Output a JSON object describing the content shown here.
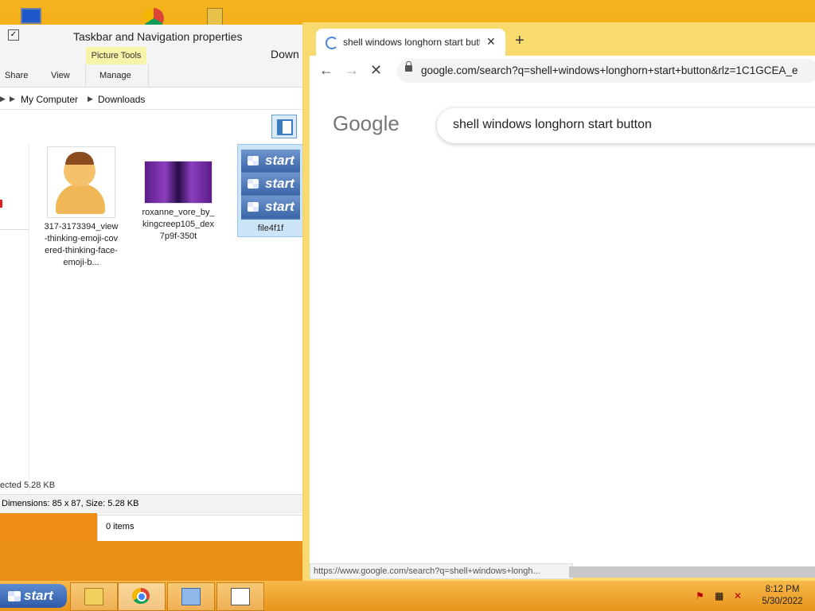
{
  "explorer": {
    "title": "Taskbar and Navigation properties",
    "ribbon": {
      "contextual_group": "Picture Tools",
      "window_title_partial": "Down",
      "tabs": [
        "Share",
        "View",
        "Manage"
      ]
    },
    "address": {
      "crumbs": [
        "My Computer",
        "Downloads"
      ]
    },
    "files": [
      {
        "name": "317-3173394_view-thinking-emoji-covered-thinking-face-emoji-b..."
      },
      {
        "name": "roxanne_vore_by_kingcreep105_dex7p9f-350t"
      },
      {
        "name": "file4f1f",
        "thumb_text": [
          "start",
          "start",
          "start"
        ]
      }
    ],
    "status": {
      "selected": "ected  5.28 KB",
      "details": "Dimensions: 85 x 87, Size: 5.28 KB",
      "items": "0 items"
    }
  },
  "chrome": {
    "tab_title": "shell windows longhorn start butt",
    "new_tab": "+",
    "url": "google.com/search?q=shell+windows+longhorn+start+button&rlz=1C1GCEA_e",
    "logo": "Google",
    "search_query": "shell windows longhorn start button",
    "status_url": "https://www.google.com/search?q=shell+windows+longh..."
  },
  "taskbar": {
    "start_label": "start",
    "clock_time": "8:12 PM",
    "clock_date": "5/30/2022"
  },
  "colors": {
    "accent": "#f0a418",
    "start_blue": "#2d5ba8",
    "chrome_frame": "#f9da6e"
  }
}
